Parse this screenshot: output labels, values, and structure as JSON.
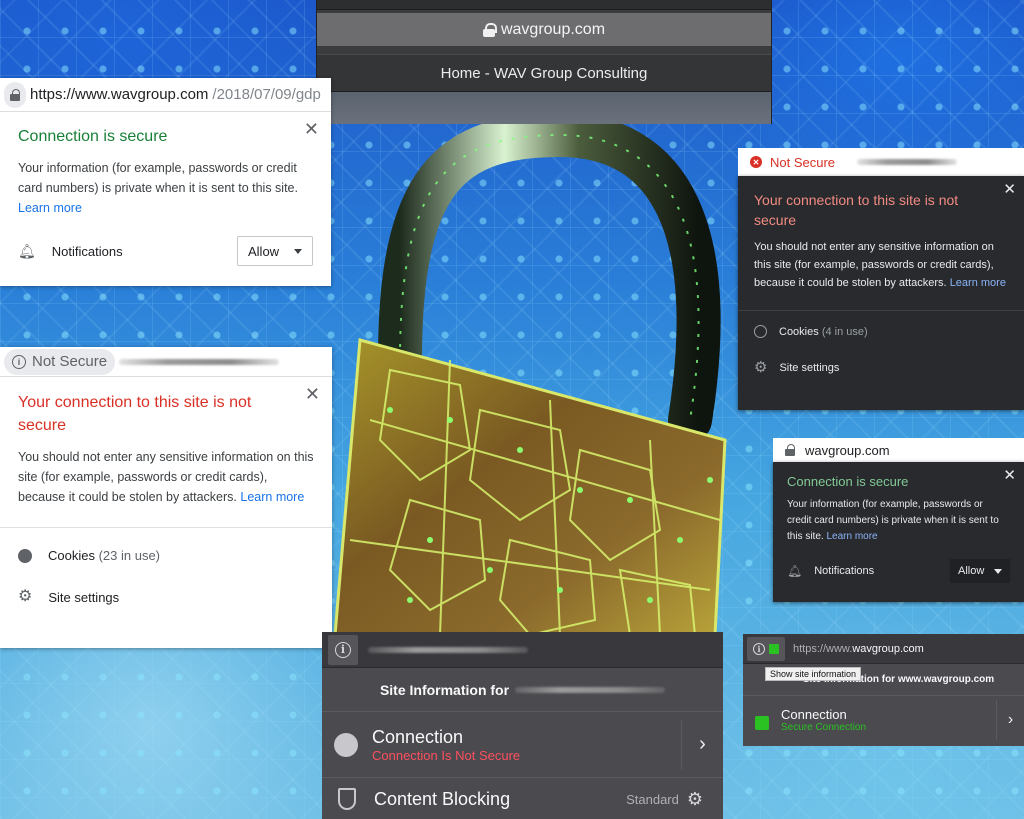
{
  "safari_bar": {
    "address": "wavgroup.com",
    "tab_title": "Home - WAV Group Consulting",
    "icon": "lock-icon"
  },
  "chrome_light_secure": {
    "url_host": "https://www.wavgroup.com",
    "url_path": "/2018/07/09/gdp",
    "title": "Connection is secure",
    "description": "Your information (for example, passwords or credit card numbers) is private when it is sent to this site.",
    "learn_more": "Learn more",
    "notifications_label": "Notifications",
    "notifications_value": "Allow",
    "close": "✕",
    "accent": "#188038"
  },
  "chrome_light_insecure": {
    "chip_label": "Not Secure",
    "title": "Your connection to this site is not secure",
    "description": "You should not enter any sensitive information on this site (for example, passwords or credit cards), because it could be stolen by attackers.",
    "learn_more": "Learn more",
    "cookies_label": "Cookies",
    "cookies_count": "(23 in use)",
    "site_settings": "Site settings",
    "close": "✕",
    "accent": "#d93025"
  },
  "chrome_dark_insecure": {
    "chip_label": "Not Secure",
    "title": "Your connection to this site is not secure",
    "description": "You should not enter any sensitive information on this site (for example, passwords or credit cards), because it could be stolen by attackers.",
    "learn_more": "Learn more",
    "cookies_label": "Cookies",
    "cookies_count": "(4 in use)",
    "site_settings": "Site settings",
    "close": "✕",
    "accent": "#f28b82"
  },
  "chrome_dark_secure": {
    "url": "wavgroup.com",
    "title": "Connection is secure",
    "description": "Your information (for example, passwords or credit card numbers) is private when it is sent to this site.",
    "learn_more": "Learn more",
    "notifications_label": "Notifications",
    "notifications_value": "Allow",
    "close": "✕",
    "accent": "#81c995"
  },
  "firefox_insecure": {
    "site_info_prefix": "Site Information for",
    "connection_label": "Connection",
    "connection_status": "Connection Is Not Secure",
    "content_blocking_label": "Content Blocking",
    "content_blocking_value": "Standard",
    "chevron": "›",
    "accent": "#ff4f5e"
  },
  "firefox_secure": {
    "url_scheme": "https://www.",
    "url_host": "wavgroup.com",
    "tooltip": "Show site information",
    "site_info": "Site Information for www.wavgroup.com",
    "connection_label": "Connection",
    "connection_status": "Secure Connection",
    "chevron": "›",
    "accent": "#2ac123"
  }
}
